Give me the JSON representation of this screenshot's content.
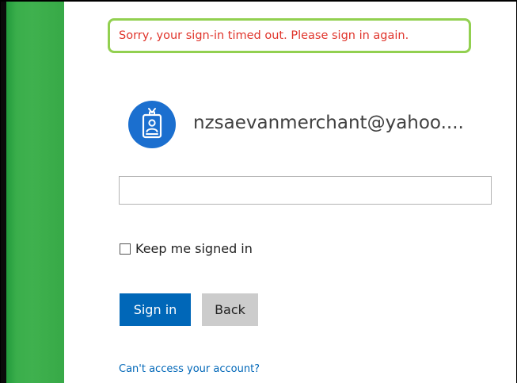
{
  "error": {
    "message": "Sorry, your sign-in timed out. Please sign in again."
  },
  "account": {
    "email": "nzsaevanmerchant@yahoo....",
    "avatar_icon": "id-badge-icon",
    "avatar_color": "#1b6fcf"
  },
  "password": {
    "value": "",
    "placeholder": ""
  },
  "keep_signed_in": {
    "label": "Keep me signed in",
    "checked": false
  },
  "buttons": {
    "sign_in": "Sign in",
    "back": "Back"
  },
  "links": {
    "cant_access": "Can't access your account?"
  },
  "colors": {
    "accent": "#0067b8",
    "error_text": "#e0342b",
    "highlight_border": "#92d050",
    "side_stripe": "#3fb14e"
  }
}
